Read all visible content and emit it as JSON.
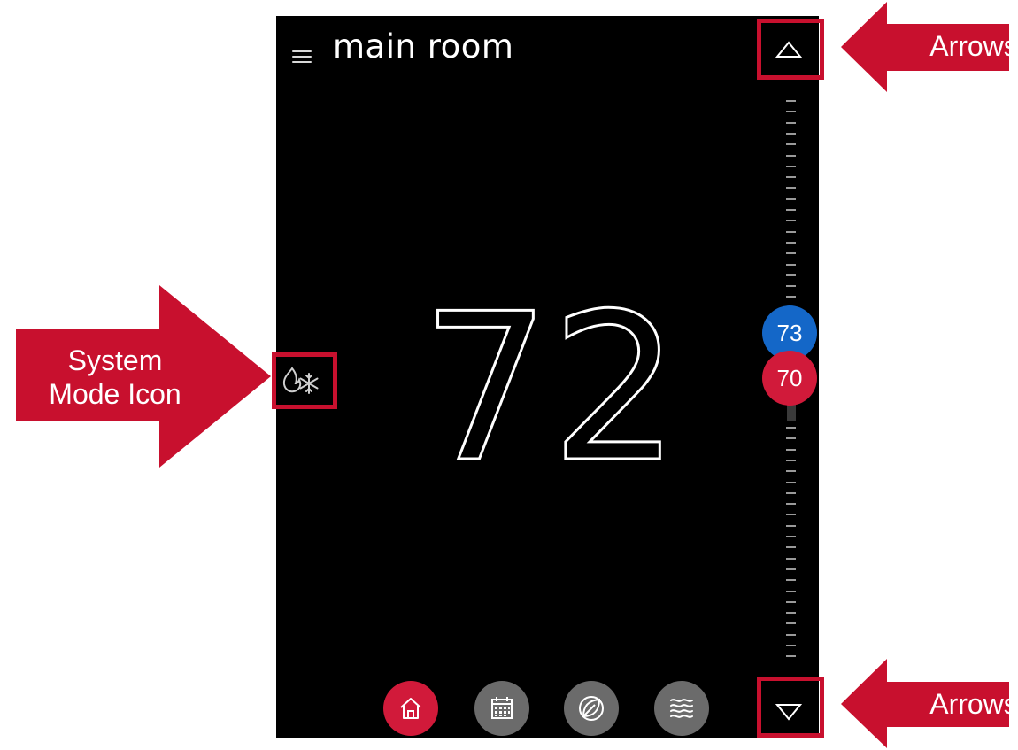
{
  "header": {
    "room_name": "main room"
  },
  "current_temperature": "72",
  "setpoints": {
    "cool": "73",
    "heat": "70",
    "cool_color": "#1467c8",
    "heat_color": "#d11a3a"
  },
  "controls": {
    "up_arrow": "up-arrow-icon",
    "down_arrow": "down-arrow-icon",
    "system_mode": "flame-snowflake-icon"
  },
  "nav": [
    {
      "id": "home",
      "icon": "home-icon",
      "active": true
    },
    {
      "id": "schedule",
      "icon": "calendar-icon",
      "active": false
    },
    {
      "id": "eco",
      "icon": "leaf-icon",
      "active": false
    },
    {
      "id": "fan",
      "icon": "air-waves-icon",
      "active": false
    }
  ],
  "annotations": {
    "arrows_top": "Arrows",
    "arrows_bottom": "Arrows",
    "system_mode_line1": "System",
    "system_mode_line2": "Mode Icon",
    "color": "#c8102e"
  }
}
